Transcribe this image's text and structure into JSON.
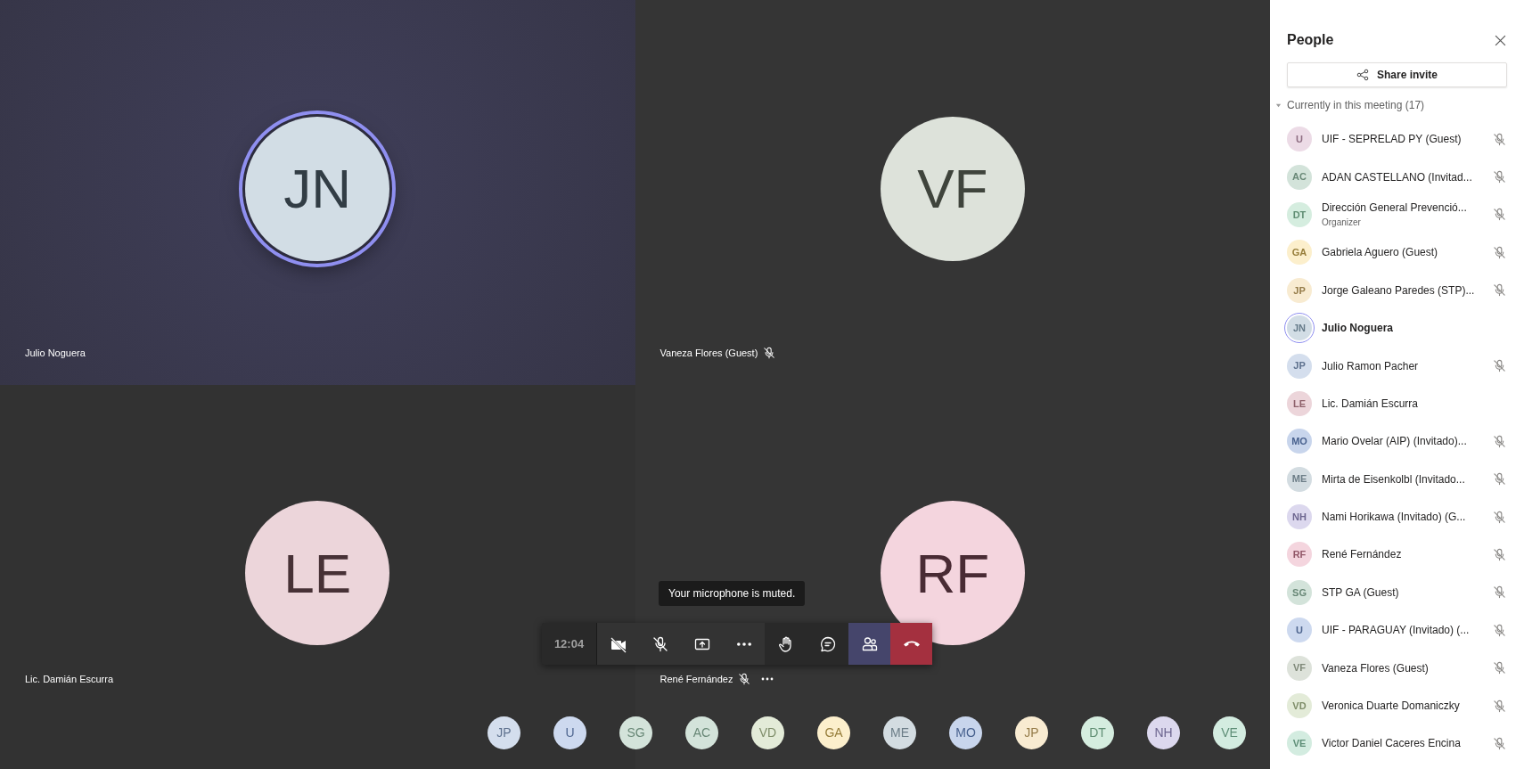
{
  "tiles": [
    {
      "initials": "JN",
      "name": "Julio Noguera",
      "color": "#d2dde5",
      "speaking": true,
      "muted": false,
      "more": false
    },
    {
      "initials": "VF",
      "name": "Vaneza Flores (Guest)",
      "color": "#dde2da",
      "speaking": false,
      "muted": true,
      "more": false
    },
    {
      "initials": "LE",
      "name": "Lic. Damián Escurra",
      "color": "#ecd5da",
      "speaking": false,
      "muted": false,
      "more": false
    },
    {
      "initials": "RF",
      "name": "René Fernández",
      "color": "#f4d5de",
      "speaking": false,
      "muted": true,
      "more": true
    }
  ],
  "tooltip": "Your microphone is muted.",
  "toolbar": {
    "time": "12:04",
    "buttons": [
      {
        "kind": "camera-off",
        "selected": false
      },
      {
        "kind": "mic-off",
        "selected": false
      },
      {
        "kind": "share",
        "selected": false
      },
      {
        "kind": "more",
        "selected": false
      },
      {
        "kind": "hand",
        "selected": false
      },
      {
        "kind": "chat",
        "selected": false
      },
      {
        "kind": "people",
        "selected": true
      },
      {
        "kind": "hangup",
        "selected": false
      }
    ]
  },
  "strip": [
    {
      "initials": "JP",
      "color": "#d4deed"
    },
    {
      "initials": "U",
      "color": "#cdd9ef"
    },
    {
      "initials": "SG",
      "color": "#d3e3da"
    },
    {
      "initials": "AC",
      "color": "#d3e3da"
    },
    {
      "initials": "VD",
      "color": "#e3ebd8"
    },
    {
      "initials": "GA",
      "color": "#fcefcc"
    },
    {
      "initials": "ME",
      "color": "#d3dce1"
    },
    {
      "initials": "MO",
      "color": "#c8d5ec"
    },
    {
      "initials": "JP",
      "color": "#f8ebd1"
    },
    {
      "initials": "DT",
      "color": "#d5eddf"
    },
    {
      "initials": "NH",
      "color": "#dcd8ee"
    },
    {
      "initials": "VE",
      "color": "#d3ece0"
    }
  ],
  "panel": {
    "title": "People",
    "share_button": "Share invite",
    "section": {
      "label": "Currently in this meeting (17)",
      "expanded": true
    },
    "people": [
      {
        "initials": "U",
        "name": "UIF - SEPRELAD PY (Guest)",
        "color": "#ecdbe6",
        "muted": true,
        "self": false
      },
      {
        "initials": "AC",
        "name": "ADAN CASTELLANO (Invitad...",
        "color": "#d3e3da",
        "muted": true,
        "self": false
      },
      {
        "initials": "DT",
        "name": "Dirección General Prevenció...",
        "role": "Organizer",
        "color": "#d5eddf",
        "muted": true,
        "self": false
      },
      {
        "initials": "GA",
        "name": "Gabriela Aguero (Guest)",
        "color": "#fcefcc",
        "muted": true,
        "self": false
      },
      {
        "initials": "JP",
        "name": "Jorge Galeano Paredes (STP)...",
        "color": "#f8ebd1",
        "muted": true,
        "self": false
      },
      {
        "initials": "JN",
        "name": "Julio Noguera",
        "color": "#d2dde5",
        "muted": false,
        "self": true
      },
      {
        "initials": "JP",
        "name": "Julio Ramon Pacher",
        "color": "#d4deed",
        "muted": true,
        "self": false
      },
      {
        "initials": "LE",
        "name": "Lic. Damián Escurra",
        "color": "#ecd5da",
        "muted": false,
        "self": false
      },
      {
        "initials": "MO",
        "name": "Mario Ovelar (AIP) (Invitado)...",
        "color": "#c8d5ec",
        "muted": true,
        "self": false
      },
      {
        "initials": "ME",
        "name": "Mirta de Eisenkolbl (Invitado...",
        "color": "#d3dce1",
        "muted": true,
        "self": false
      },
      {
        "initials": "NH",
        "name": "Nami Horikawa (Invitado) (G...",
        "color": "#dcd8ee",
        "muted": true,
        "self": false
      },
      {
        "initials": "RF",
        "name": "René Fernández",
        "color": "#f4d5de",
        "muted": true,
        "self": false
      },
      {
        "initials": "SG",
        "name": "STP GA (Guest)",
        "color": "#d3e3da",
        "muted": true,
        "self": false
      },
      {
        "initials": "U",
        "name": "UIF - PARAGUAY (Invitado) (...",
        "color": "#cdd9ef",
        "muted": true,
        "self": false
      },
      {
        "initials": "VF",
        "name": "Vaneza Flores (Guest)",
        "color": "#dde2da",
        "muted": true,
        "self": false
      },
      {
        "initials": "VD",
        "name": "Veronica Duarte Domaniczky",
        "color": "#e3ebd8",
        "muted": true,
        "self": false
      },
      {
        "initials": "VE",
        "name": "Victor Daniel Caceres Encina",
        "color": "#d3ece0",
        "muted": true,
        "self": false
      }
    ]
  }
}
